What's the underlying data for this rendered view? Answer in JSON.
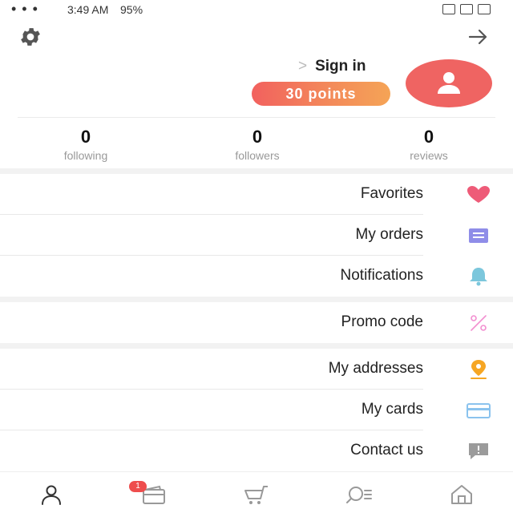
{
  "status_bar": {
    "time": "3:49 AM",
    "battery": "95%",
    "overflow": "• • •"
  },
  "profile": {
    "sign_in_label": "Sign in",
    "chevron": ">",
    "points_label": "30 points"
  },
  "stats": [
    {
      "value": "0",
      "label": "reviews"
    },
    {
      "value": "0",
      "label": "followers"
    },
    {
      "value": "0",
      "label": "following"
    }
  ],
  "menu": [
    {
      "label": "Favorites",
      "icon": "heart-icon",
      "color": "#ee5b78"
    },
    {
      "label": "My orders",
      "icon": "orders-icon",
      "color": "#8f8de8"
    },
    {
      "label": "Notifications",
      "icon": "bell-icon",
      "color": "#7cc7dc"
    },
    {
      "label": "Promo code",
      "icon": "percent-icon",
      "color": "#f28fd0"
    },
    {
      "label": "My addresses",
      "icon": "location-pin-icon",
      "color": "#f6a623"
    },
    {
      "label": "My cards",
      "icon": "card-icon",
      "color": "#8bc3ee"
    },
    {
      "label": "Contact us",
      "icon": "chat-alert-icon",
      "color": "#9b9b9b"
    }
  ],
  "bottom_nav": {
    "items": [
      "profile-icon",
      "wallet-icon",
      "cart-icon",
      "search-icon",
      "home-icon"
    ],
    "wallet_badge": "1"
  },
  "colors": {
    "accent": "#ef6462",
    "points_gradient_start": "#f2615e",
    "points_gradient_end": "#f5a456",
    "badge": "#ee4d4d"
  }
}
